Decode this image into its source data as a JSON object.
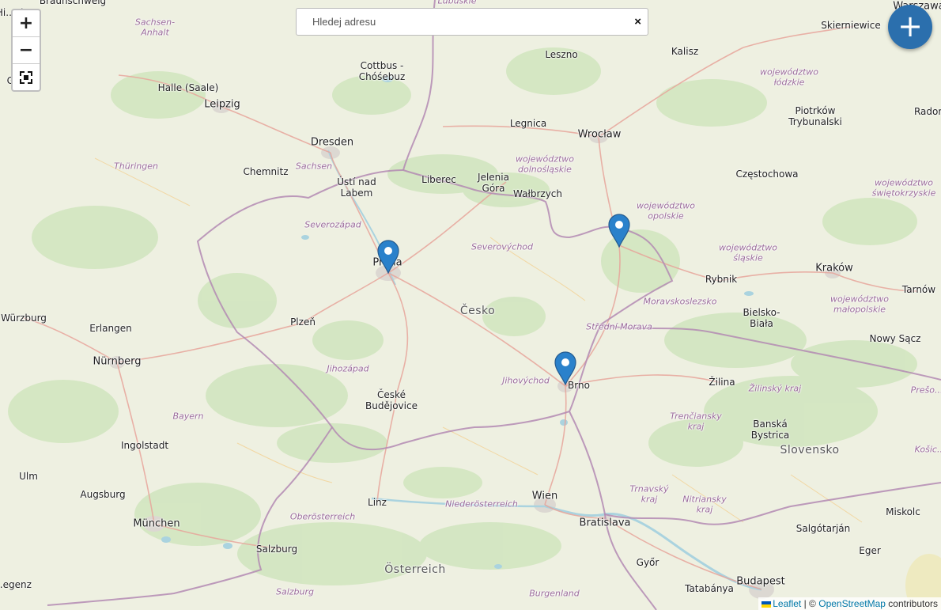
{
  "search": {
    "placeholder": "Hledej adresu",
    "clear_label": "×"
  },
  "zoom": {
    "in_label": "+",
    "out_label": "−"
  },
  "fab_label": "+",
  "attribution": {
    "leaflet": "Leaflet",
    "separator": "| ©",
    "osm": "OpenStreetMap",
    "suffix": "contributors"
  },
  "marker_color": "#2a81cb",
  "labels": [
    {
      "text": "Braunschweig",
      "kind": "city",
      "id": "braunschweig"
    },
    {
      "text": "Hi...eim",
      "kind": "city",
      "id": "hildesheim"
    },
    {
      "text": "Sachsen-\nAnhalt",
      "kind": "region",
      "id": "sachsen-anhalt"
    },
    {
      "text": "Lubuskie",
      "kind": "region",
      "id": "lubuskie"
    },
    {
      "text": "Warszawa",
      "kind": "big",
      "id": "warszawa"
    },
    {
      "text": "Skierniewice",
      "kind": "city",
      "id": "skierniewice"
    },
    {
      "text": "Kalisz",
      "kind": "city",
      "id": "kalisz"
    },
    {
      "text": "Leszno",
      "kind": "city",
      "id": "leszno"
    },
    {
      "text": "Cottbus -\nChóśebuz",
      "kind": "city",
      "id": "cottbus"
    },
    {
      "text": "Halle (Saale)",
      "kind": "city",
      "id": "halle"
    },
    {
      "text": "Go...en",
      "kind": "city",
      "id": "gotingen"
    },
    {
      "text": "Leipzig",
      "kind": "big",
      "id": "leipzig"
    },
    {
      "text": "województwo\nłódzkie",
      "kind": "region",
      "id": "lodzkie"
    },
    {
      "text": "Piotrków\nTrybunalski",
      "kind": "city",
      "id": "piotrkow"
    },
    {
      "text": "Radom",
      "kind": "city",
      "id": "radom"
    },
    {
      "text": "Legnica",
      "kind": "city",
      "id": "legnica"
    },
    {
      "text": "Wrocław",
      "kind": "big",
      "id": "wroclaw"
    },
    {
      "text": "Dresden",
      "kind": "big",
      "id": "dresden"
    },
    {
      "text": "województwo\ndolnośląskie",
      "kind": "region",
      "id": "dolnoslaskie"
    },
    {
      "text": "Thüringen",
      "kind": "region",
      "id": "thuringen"
    },
    {
      "text": "Chemnitz",
      "kind": "city",
      "id": "chemnitz"
    },
    {
      "text": "Sachsen",
      "kind": "region",
      "id": "sachsen"
    },
    {
      "text": "Częstochowa",
      "kind": "city",
      "id": "czestochowa"
    },
    {
      "text": "województwo\nświętokrzyskie",
      "kind": "region",
      "id": "swietokrzyskie"
    },
    {
      "text": "Ústí nad\nLabem",
      "kind": "city",
      "id": "usti"
    },
    {
      "text": "Liberec",
      "kind": "city",
      "id": "liberec"
    },
    {
      "text": "Jelenia\nGóra",
      "kind": "city",
      "id": "jelenia"
    },
    {
      "text": "Wałbrzych",
      "kind": "city",
      "id": "walbrzych"
    },
    {
      "text": "województwo\nopolskie",
      "kind": "region",
      "id": "opolskie"
    },
    {
      "text": "Severozápad",
      "kind": "region",
      "id": "severozapad"
    },
    {
      "text": "Severovýchod",
      "kind": "region",
      "id": "severovychod"
    },
    {
      "text": "województwo\nśląskie",
      "kind": "region",
      "id": "slaskie"
    },
    {
      "text": "Praha",
      "kind": "big",
      "id": "praha"
    },
    {
      "text": "Rybnik",
      "kind": "city",
      "id": "rybnik"
    },
    {
      "text": "Kraków",
      "kind": "big",
      "id": "krakow"
    },
    {
      "text": "Tarnów",
      "kind": "city",
      "id": "tarnow"
    },
    {
      "text": "Moravskoslezsko",
      "kind": "region",
      "id": "moravskoslezsko"
    },
    {
      "text": "województwo\nmałopolskie",
      "kind": "region",
      "id": "malopolskie"
    },
    {
      "text": "Würzburg",
      "kind": "city",
      "id": "wurzburg"
    },
    {
      "text": "Česko",
      "kind": "country",
      "id": "cesko"
    },
    {
      "text": "Bielsko-\nBiała",
      "kind": "city",
      "id": "bielsko"
    },
    {
      "text": "Plzeň",
      "kind": "city",
      "id": "plzen"
    },
    {
      "text": "Erlangen",
      "kind": "city",
      "id": "erlangen"
    },
    {
      "text": "Střední Morava",
      "kind": "region",
      "id": "stredni-morava"
    },
    {
      "text": "Nowy Sącz",
      "kind": "city",
      "id": "nowy-sacz"
    },
    {
      "text": "Nürnberg",
      "kind": "big",
      "id": "nurnberg"
    },
    {
      "text": "Jihozápad",
      "kind": "region",
      "id": "jihozapad"
    },
    {
      "text": "Jihovýchod",
      "kind": "region",
      "id": "jihovychod"
    },
    {
      "text": "Brno",
      "kind": "city",
      "id": "brno"
    },
    {
      "text": "Žilina",
      "kind": "city",
      "id": "zilina"
    },
    {
      "text": "Žilinský kraj",
      "kind": "region",
      "id": "zilinsky"
    },
    {
      "text": "Prešo...",
      "kind": "region",
      "id": "presov"
    },
    {
      "text": "České\nBudějovice",
      "kind": "city",
      "id": "budejovice"
    },
    {
      "text": "Bayern",
      "kind": "region",
      "id": "bayern"
    },
    {
      "text": "Trenčiansky\nkraj",
      "kind": "region",
      "id": "trenciansky"
    },
    {
      "text": "Banská\nBystrica",
      "kind": "city",
      "id": "banska"
    },
    {
      "text": "Ingolstadt",
      "kind": "city",
      "id": "ingolstadt"
    },
    {
      "text": "Slovensko",
      "kind": "country",
      "id": "slovensko"
    },
    {
      "text": "Košic...",
      "kind": "region",
      "id": "kosice"
    },
    {
      "text": "Ulm",
      "kind": "city",
      "id": "ulm"
    },
    {
      "text": "Augsburg",
      "kind": "city",
      "id": "augsburg"
    },
    {
      "text": "Trnavský\nkraj",
      "kind": "region",
      "id": "trnavsky"
    },
    {
      "text": "Linz",
      "kind": "city",
      "id": "linz"
    },
    {
      "text": "Wien",
      "kind": "big",
      "id": "wien"
    },
    {
      "text": "Nitriansky\nkraj",
      "kind": "region",
      "id": "nitriansky"
    },
    {
      "text": "Niederösterreich",
      "kind": "region",
      "id": "niederosterreich"
    },
    {
      "text": "Miskolc",
      "kind": "city",
      "id": "miskolc"
    },
    {
      "text": "Oberösterreich",
      "kind": "region",
      "id": "oberosterreich"
    },
    {
      "text": "Bratislava",
      "kind": "big",
      "id": "bratislava"
    },
    {
      "text": "München",
      "kind": "big",
      "id": "munchen"
    },
    {
      "text": "Salgótarján",
      "kind": "city",
      "id": "salgotarjan"
    },
    {
      "text": "Salzburg",
      "kind": "city",
      "id": "salzburg"
    },
    {
      "text": "Eger",
      "kind": "city",
      "id": "eger"
    },
    {
      "text": "Győr",
      "kind": "city",
      "id": "gyor"
    },
    {
      "text": "Österreich",
      "kind": "country",
      "id": "osterreich"
    },
    {
      "text": "Budapest",
      "kind": "big",
      "id": "budapest"
    },
    {
      "text": "...egenz",
      "kind": "city",
      "id": "bregenz"
    },
    {
      "text": "Salzburg",
      "kind": "region",
      "id": "salzburg-region"
    },
    {
      "text": "Burgenland",
      "kind": "region",
      "id": "burgenland"
    },
    {
      "text": "Tatabánya",
      "kind": "city",
      "id": "tatabanya"
    }
  ]
}
